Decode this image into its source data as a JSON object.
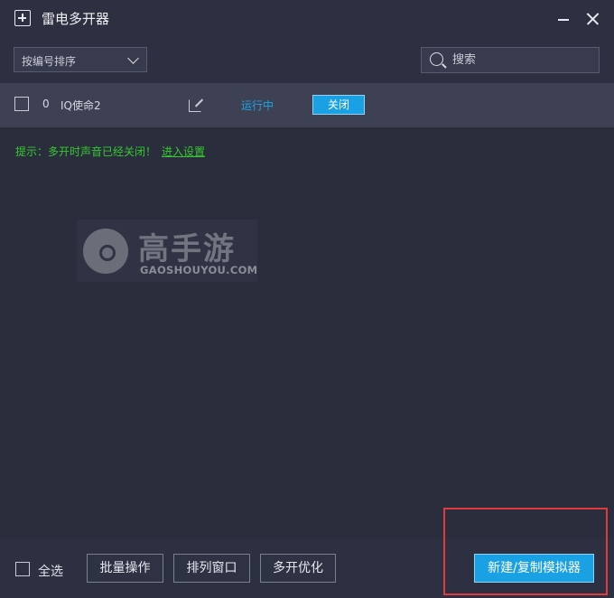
{
  "window": {
    "title": "雷电多开器"
  },
  "toolbar": {
    "sort_label": "按编号排序",
    "search_placeholder": "搜索"
  },
  "instances": [
    {
      "index": "0",
      "name": "IQ使命2",
      "status": "运行中",
      "action_label": "关闭"
    }
  ],
  "tip": {
    "text": "提示：多开时声音已经关闭！",
    "link": "进入设置"
  },
  "watermark": {
    "brand": "高手游",
    "domain": "GAOSHOUYOU.COM"
  },
  "footer": {
    "select_all": "全选",
    "batch_label": "批量操作",
    "arrange_label": "排列窗口",
    "optimize_label": "多开优化",
    "new_label": "新建/复制模拟器"
  },
  "colors": {
    "accent": "#1aa1e4",
    "tip_green": "#35c82f",
    "highlight_red": "#e0393e"
  }
}
